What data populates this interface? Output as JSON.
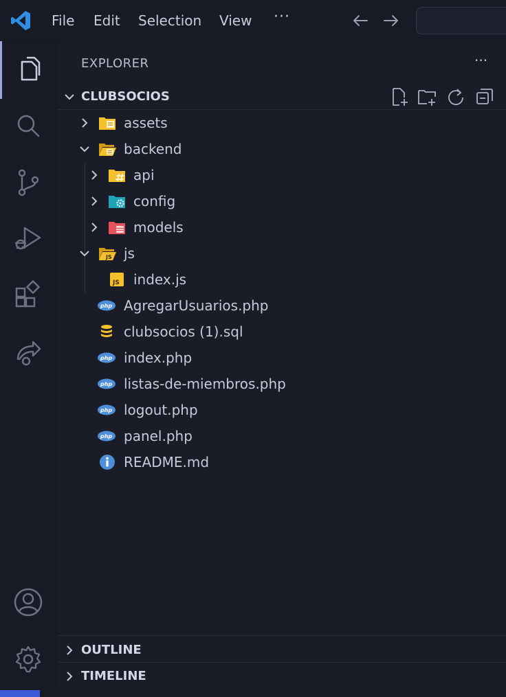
{
  "titlebar": {
    "menu": [
      "File",
      "Edit",
      "Selection",
      "View"
    ],
    "more": "···"
  },
  "activitybar": {
    "items": [
      "files-icon",
      "search-icon",
      "source-control-icon",
      "run-debug-icon",
      "extensions-icon",
      "live-share-icon"
    ],
    "bottom": [
      "account-icon",
      "settings-gear-icon"
    ],
    "active": "files-icon"
  },
  "explorer": {
    "title": "EXPLORER",
    "more": "···",
    "folder": "CLUBSOCIOS",
    "actions": [
      "new-file-icon",
      "new-folder-icon",
      "refresh-icon",
      "collapse-all-icon"
    ]
  },
  "tree": {
    "assets": "assets",
    "backend": "backend",
    "api": "api",
    "config": "config",
    "models": "models",
    "js": "js",
    "index_js": "index.js",
    "agregar": "AgregarUsuarios.php",
    "sql": "clubsocios (1).sql",
    "index_php": "index.php",
    "listas": "listas-de-miembros.php",
    "logout": "logout.php",
    "panel": "panel.php",
    "readme": "README.md"
  },
  "sections": {
    "outline": "OUTLINE",
    "timeline": "TIMELINE"
  },
  "colors": {
    "background": "#181a25",
    "sidebar": "#1a1c27",
    "accent": "#3c5bd6",
    "folder_yellow": "#f6c02c",
    "php_blue": "#4d8fd8"
  }
}
